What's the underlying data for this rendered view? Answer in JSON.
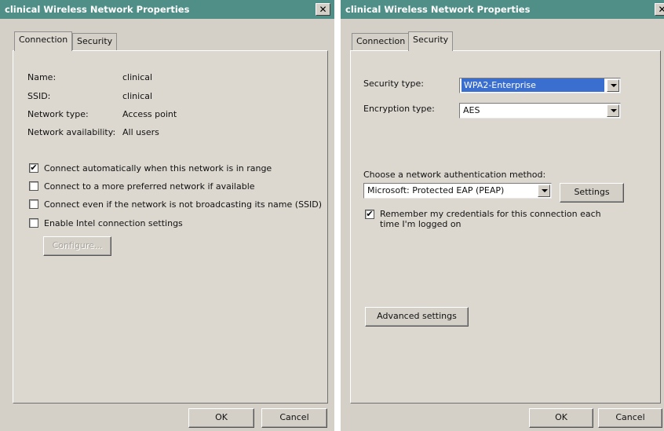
{
  "left_dialog": {
    "title": "clinical Wireless Network Properties",
    "close_glyph": "✕",
    "tabs": [
      {
        "label": "Connection",
        "active": true
      },
      {
        "label": "Security",
        "active": false
      }
    ],
    "fields": [
      {
        "label": "Name:",
        "value": "clinical"
      },
      {
        "label": "SSID:",
        "value": "clinical"
      },
      {
        "label": "Network type:",
        "value": "Access point"
      },
      {
        "label": "Network availability:",
        "value": "All users"
      }
    ],
    "checkboxes": [
      {
        "label": "Connect automatically when this network is in range",
        "checked": true
      },
      {
        "label": "Connect to a more preferred network if available",
        "checked": false
      },
      {
        "label": "Connect even if the network is not broadcasting its name (SSID)",
        "checked": false
      },
      {
        "label": "Enable Intel connection settings",
        "checked": false
      }
    ],
    "configure_label": "Configure...",
    "ok_label": "OK",
    "cancel_label": "Cancel"
  },
  "right_dialog": {
    "title": "clinical Wireless Network Properties",
    "close_glyph": "✕",
    "tabs": [
      {
        "label": "Connection",
        "active": false
      },
      {
        "label": "Security",
        "active": true
      }
    ],
    "security_type_label": "Security type:",
    "security_type_value": "WPA2-Enterprise",
    "encryption_type_label": "Encryption type:",
    "encryption_type_value": "AES",
    "auth_method_label": "Choose a network authentication method:",
    "auth_method_value": "Microsoft: Protected EAP (PEAP)",
    "settings_label": "Settings",
    "remember_label_line1": "Remember my credentials for this connection each",
    "remember_label_line2": "time I'm logged on",
    "remember_checked": true,
    "advanced_label": "Advanced settings",
    "ok_label": "OK",
    "cancel_label": "Cancel"
  },
  "check_glyph": "✔"
}
